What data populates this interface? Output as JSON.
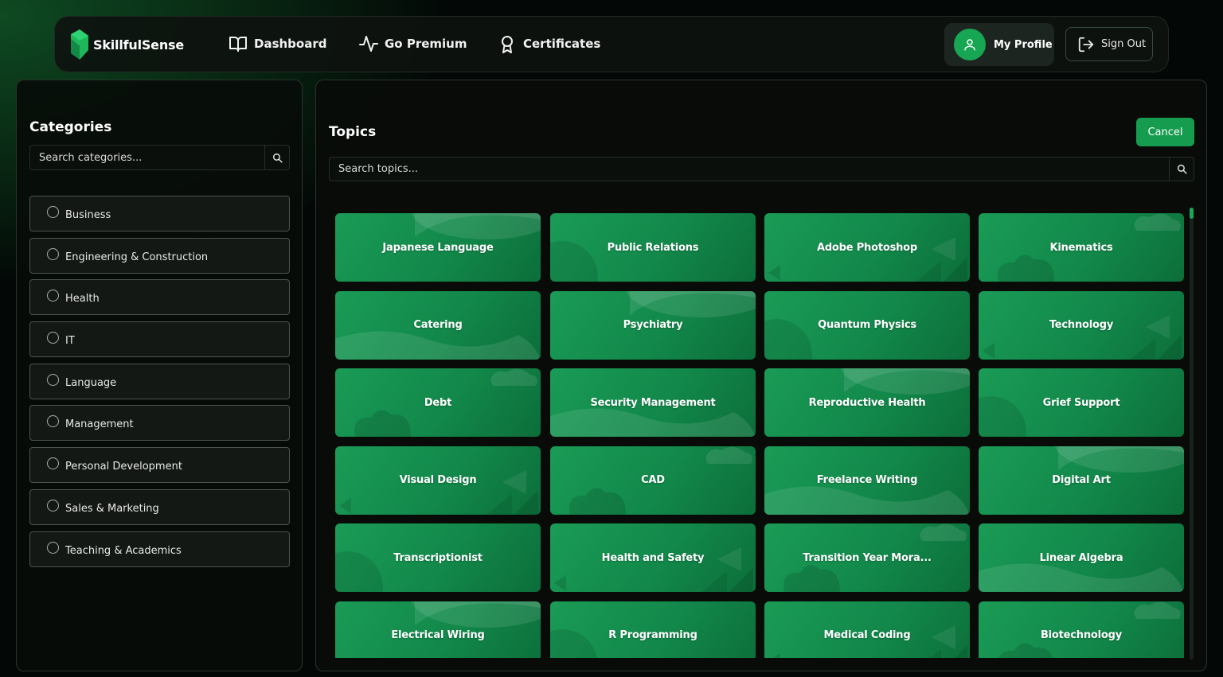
{
  "brand": {
    "name": "SkillfulSense",
    "accent": "#17a654"
  },
  "nav": {
    "dashboard": "Dashboard",
    "premium": "Go Premium",
    "certificates": "Certificates",
    "profile": "My Profile",
    "signout": "Sign Out"
  },
  "categories": {
    "title": "Categories",
    "search_placeholder": "Search categories...",
    "items": [
      "Business",
      "Engineering & Construction",
      "Health",
      "IT",
      "Language",
      "Management",
      "Personal Development",
      "Sales & Marketing",
      "Teaching & Academics"
    ]
  },
  "topics": {
    "title": "Topics",
    "cancel": "Cancel",
    "search_placeholder": "Search topics...",
    "items": [
      "Japanese Language",
      "Public Relations",
      "Adobe Photoshop",
      "Kinematics",
      "Catering",
      "Psychiatry",
      "Quantum Physics",
      "Technology",
      "Debt",
      "Security Management",
      "Reproductive Health",
      "Grief Support",
      "Visual Design",
      "CAD",
      "Freelance Writing",
      "Digital Art",
      "Transcriptionist",
      "Health and Safety",
      "Transition Year Mora...",
      "Linear Algebra",
      "Electrical Wiring",
      "R Programming",
      "Medical Coding",
      "Biotechnology"
    ]
  },
  "icons": {
    "dashboard": "book-open-icon",
    "premium": "activity-icon",
    "certificates": "award-icon",
    "profile": "user-icon",
    "signout": "log-out-icon",
    "search": "search-icon"
  }
}
